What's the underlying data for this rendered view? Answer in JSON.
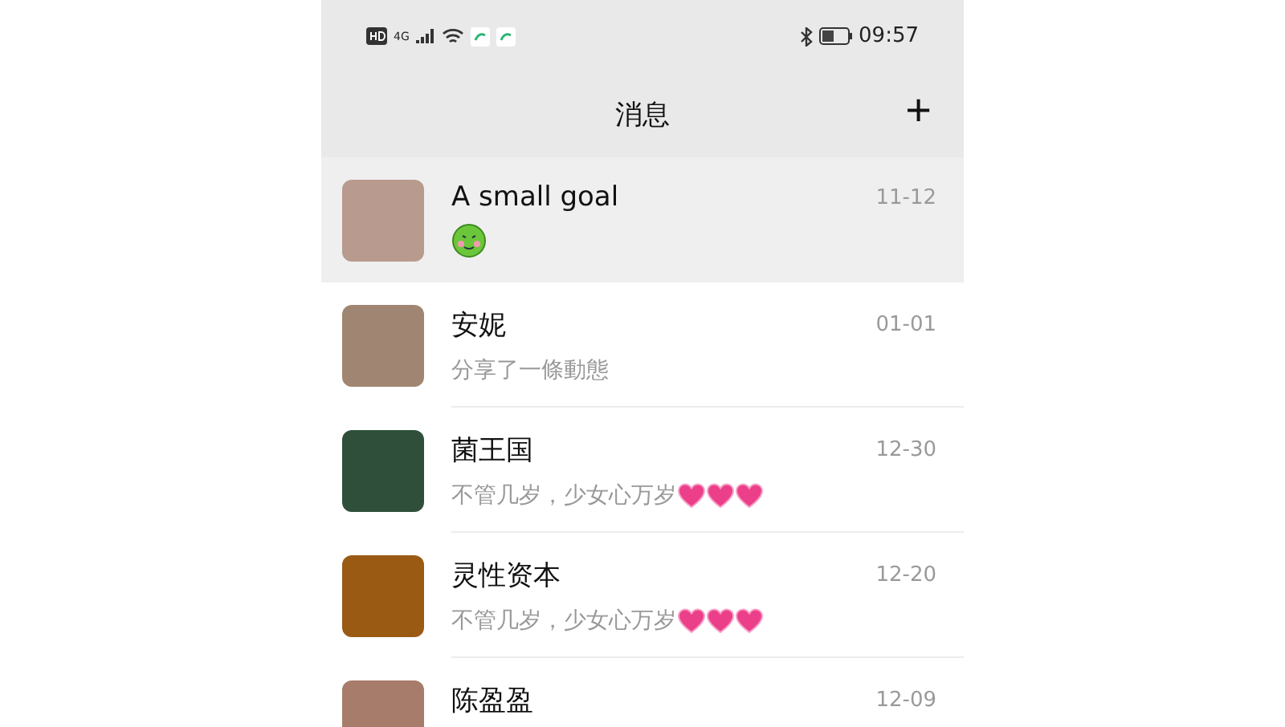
{
  "status_bar": {
    "time": "09:57",
    "network": "4G"
  },
  "header": {
    "title": "消息",
    "add_button": "+"
  },
  "chats": [
    {
      "name": "A small goal",
      "date": "11-12",
      "selected": true,
      "stickers": [
        {
          "kind": "frog"
        }
      ]
    },
    {
      "name": "安妮",
      "date": "01-01",
      "selected": false,
      "preview": "分享了一條動態"
    },
    {
      "name": "菌王国",
      "date": "12-30",
      "selected": false,
      "preview": "不管几岁，少女心万岁",
      "stickers": [
        {
          "kind": "heart"
        },
        {
          "kind": "heart"
        },
        {
          "kind": "heart"
        }
      ]
    },
    {
      "name": "灵性资本",
      "date": "12-20",
      "selected": false,
      "preview": "不管几岁，少女心万岁",
      "stickers": [
        {
          "kind": "heart"
        },
        {
          "kind": "heart"
        },
        {
          "kind": "heart"
        }
      ]
    },
    {
      "name": "陈盈盈",
      "date": "12-09",
      "selected": false
    }
  ]
}
